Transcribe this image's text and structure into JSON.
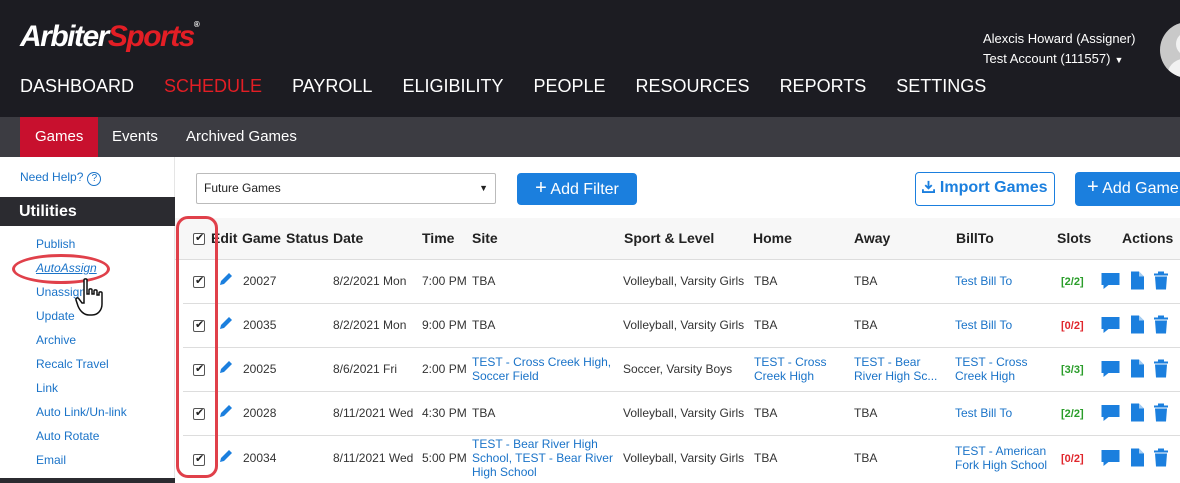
{
  "header": {
    "logo_part1": "Arbiter",
    "logo_part2": "Sports",
    "logo_tm": "®",
    "user_name": "Alexcis Howard (Assigner)",
    "account": "Test Account (111557)"
  },
  "main_nav": [
    "DASHBOARD",
    "SCHEDULE",
    "PAYROLL",
    "ELIGIBILITY",
    "PEOPLE",
    "RESOURCES",
    "REPORTS",
    "SETTINGS"
  ],
  "main_nav_active": "SCHEDULE",
  "sub_nav": {
    "games": "Games",
    "events": "Events",
    "archived": "Archived Games"
  },
  "sidebar": {
    "help": "Need Help?",
    "utilities_title": "Utilities",
    "items": [
      "Publish",
      "AutoAssign",
      "Unassign",
      "Update",
      "Archive",
      "Recalc Travel",
      "Link",
      "Auto Link/Un-link",
      "Auto Rotate",
      "Email"
    ]
  },
  "toolbar": {
    "filter_value": "Future Games",
    "add_filter": "Add Filter",
    "import_games": "Import Games",
    "add_game": "Add Game"
  },
  "table": {
    "headers": {
      "edit": "Edit",
      "game": "Game",
      "status": "Status",
      "date": "Date",
      "time": "Time",
      "site": "Site",
      "sport": "Sport & Level",
      "home": "Home",
      "away": "Away",
      "billto": "BillTo",
      "slots": "Slots",
      "actions": "Actions"
    },
    "rows": [
      {
        "game": "20027",
        "date": "8/2/2021 Mon",
        "time": "7:00 PM",
        "site": "TBA",
        "sport": "Volleyball, Varsity Girls",
        "home": "TBA",
        "away": "TBA",
        "billto": "Test Bill To",
        "slots": "[2/2]",
        "slots_status": "full"
      },
      {
        "game": "20035",
        "date": "8/2/2021 Mon",
        "time": "9:00 PM",
        "site": "TBA",
        "sport": "Volleyball, Varsity Girls",
        "home": "TBA",
        "away": "TBA",
        "billto": "Test Bill To",
        "slots": "[0/2]",
        "slots_status": "open"
      },
      {
        "game": "20025",
        "date": "8/6/2021 Fri",
        "time": "2:00 PM",
        "site_l1": "TEST - Cross Creek High,",
        "site_l2": "Soccer Field",
        "sport": "Soccer, Varsity Boys",
        "home_l1": "TEST - Cross",
        "home_l2": "Creek High",
        "away_l1": "TEST - Bear",
        "away_l2": "River High Sc...",
        "billto_l1": "TEST - Cross",
        "billto_l2": "Creek High",
        "slots": "[3/3]",
        "slots_status": "full"
      },
      {
        "game": "20028",
        "date": "8/11/2021 Wed",
        "time": "4:30 PM",
        "site": "TBA",
        "sport": "Volleyball, Varsity Girls",
        "home": "TBA",
        "away": "TBA",
        "billto": "Test Bill To",
        "slots": "[2/2]",
        "slots_status": "full"
      },
      {
        "game": "20034",
        "date": "8/11/2021 Wed",
        "time": "5:00 PM",
        "site_l1": "TEST - Bear River High",
        "site_l2": "School, TEST - Bear River",
        "site_l3": "High School",
        "sport": "Volleyball, Varsity Girls",
        "home": "TBA",
        "away": "TBA",
        "billto_l1": "TEST - American",
        "billto_l2": "Fork High School",
        "slots": "[0/2]",
        "slots_status": "open"
      }
    ]
  },
  "colors": {
    "brand_red": "#e31e25",
    "primary_blue": "#1b7fde",
    "link_blue": "#1a73c8",
    "annotation_red": "#e0404a"
  }
}
